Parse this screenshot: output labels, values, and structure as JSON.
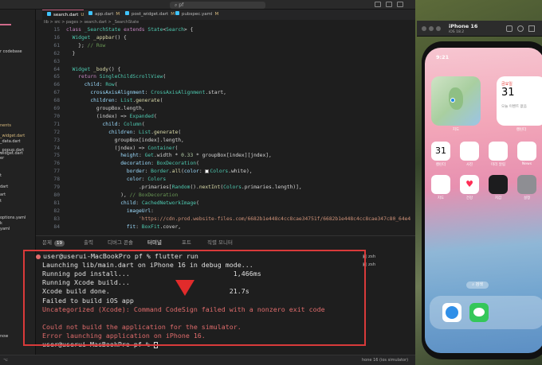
{
  "titlebar": {
    "search": "pf"
  },
  "tabs": [
    {
      "label": "search.dart",
      "modified": "U",
      "active": true
    },
    {
      "label": "app.dart",
      "modified": "M",
      "active": false
    },
    {
      "label": "post_widget.dart",
      "modified": "M",
      "active": false
    },
    {
      "label": "pubspec.yaml",
      "modified": "M",
      "active": false
    }
  ],
  "breadcrumb": "lib > src > pages > search.dart > _SearchState",
  "sidebar": {
    "items": [
      {
        "label": "r codebase",
        "color": "#d0d0d0"
      },
      {
        "label": "nents",
        "color": "#d7ba7d"
      },
      {
        "label": "_widget.dart",
        "color": "#d7ba7d"
      },
      {
        "label": "_data.dart",
        "color": "#d0d0d0"
      },
      {
        "label": "_popup.dart",
        "color": "#d0d0d0"
      },
      {
        "label": "widget.dart",
        "color": "#d0d0d0"
      },
      {
        "label": "er",
        "color": "#d0d0d0"
      },
      {
        "label": "t",
        "color": "#d0d0d0"
      },
      {
        "label": "dart",
        "color": "#d0d0d0"
      },
      {
        "label": "art",
        "color": "#d0d0d0"
      },
      {
        "label": "t",
        "color": "#d0d0d0"
      },
      {
        "label": "options.yaml",
        "color": "#d0d0d0"
      },
      {
        "label": "k",
        "color": "#d0d0d0"
      },
      {
        "label": "yaml",
        "color": "#d0d0d0"
      },
      {
        "label": "now",
        "color": "#d0d0d0"
      }
    ]
  },
  "editor": {
    "lines": [
      {
        "n": "15",
        "html": "<span class='kw'>class</span> <span class='ty'>_SearchState</span> <span class='kw'>extends</span> <span class='ty'>State</span>&lt;<span class='ty'>Search</span>&gt; {"
      },
      {
        "n": "16",
        "html": "  <span class='ty'>Widget</span> <span class='fn'>_appbar</span>() {"
      },
      {
        "n": "61",
        "html": "    }; <span class='cm'>// Row</span>"
      },
      {
        "n": "62",
        "html": "  }"
      },
      {
        "n": "63",
        "html": ""
      },
      {
        "n": "64",
        "html": "  <span class='ty'>Widget</span> <span class='fn'>_body</span>() {"
      },
      {
        "n": "65",
        "html": "    <span class='kw'>return</span> <span class='ty'>SingleChildScrollView</span>("
      },
      {
        "n": "66",
        "html": "      <span class='pr'>child</span>: <span class='ty'>Row</span>("
      },
      {
        "n": "67",
        "html": "        <span class='pr'>crossAxisAlignment</span>: <span class='ty'>CrossAxisAlignment</span>.start,"
      },
      {
        "n": "68",
        "html": "        <span class='pr'>children</span>: <span class='ty'>List</span>.<span class='fn'>generate</span>("
      },
      {
        "n": "69",
        "html": "          groupBox.length,"
      },
      {
        "n": "70",
        "html": "          (index) =&gt; <span class='ty'>Expanded</span>("
      },
      {
        "n": "71",
        "html": "            <span class='pr'>child</span>: <span class='ty'>Column</span>("
      },
      {
        "n": "72",
        "html": "              <span class='pr'>children</span>: <span class='ty'>List</span>.<span class='fn'>generate</span>("
      },
      {
        "n": "73",
        "html": "                groupBox[index].length,"
      },
      {
        "n": "74",
        "html": "                (jndex) =&gt; <span class='ty'>Container</span>("
      },
      {
        "n": "75",
        "html": "                  <span class='pr'>height</span>: <span class='ty'>Get</span>.width * <span class='nm'>0.33</span> * groupBox[index][jndex],"
      },
      {
        "n": "76",
        "html": "                  <span class='pr'>decoration</span>: <span class='ty'>BoxDecoration</span>("
      },
      {
        "n": "77",
        "html": "                    <span class='pr'>border</span>: <span class='ty'>Border</span>.<span class='fn'>all</span>(<span class='pr'>color</span>: <span class='swatch'></span><span class='ty'>Colors</span>.white),"
      },
      {
        "n": "78",
        "html": "                    <span class='pr'>color</span>: <span class='ty'>Colors</span>"
      },
      {
        "n": "79",
        "html": "                        .primaries[<span class='ty'>Random</span>().<span class='fn'>nextInt</span>(<span class='ty'>Colors</span>.primaries.length)],"
      },
      {
        "n": "80",
        "html": "                  ), <span class='cm'>// BoxDecoration</span>"
      },
      {
        "n": "81",
        "html": "                  <span class='pr'>child</span>: <span class='ty'>CachedNetworkImage</span>("
      },
      {
        "n": "82",
        "html": "                    <span class='pr'>imageUrl</span>:"
      },
      {
        "n": "83",
        "html": "                        <span class='st'>'https://cdn.prod.website-files.com/6682b1e448c4cc8cae34751f/6682b1e448c4cc8cae347c80_64e4</span>"
      },
      {
        "n": "84",
        "html": "                    <span class='pr'>fit</span>: <span class='ty'>BoxFit</span>.cover,"
      }
    ]
  },
  "panel": {
    "tabs": [
      {
        "label": "문제",
        "badge": "19",
        "active": false
      },
      {
        "label": "출력",
        "active": false
      },
      {
        "label": "디버그 콘솔",
        "active": false
      },
      {
        "label": "터미널",
        "active": true
      },
      {
        "label": "포트",
        "active": false
      },
      {
        "label": "직렬 모니터",
        "active": false
      }
    ],
    "terminal_sessions": [
      "zsh",
      "zsh"
    ]
  },
  "terminal": {
    "lines": [
      {
        "text": "user@userui-MacBookPro pf % flutter run",
        "err": false,
        "dot": true
      },
      {
        "text": "Launching lib/main.dart on iPhone 16 in debug mode...",
        "err": false
      },
      {
        "text": "Running pod install...                          1,466ms",
        "err": false
      },
      {
        "text": "Running Xcode build...",
        "err": false
      },
      {
        "text": "Xcode build done.                              21.7s",
        "err": false
      },
      {
        "text": "Failed to build iOS app",
        "err": false
      },
      {
        "text": "Uncategorized (Xcode): Command CodeSign failed with a nonzero exit code",
        "err": true
      },
      {
        "text": "",
        "err": false
      },
      {
        "text": "Could not build the application for the simulator.",
        "err": true
      },
      {
        "text": "Error launching application on iPhone 16.",
        "err": true
      },
      {
        "text": "user@userui-MacBookPro pf % ",
        "err": false
      }
    ]
  },
  "statusbar": {
    "right": "hone 16 (ios simulator)"
  },
  "simulator": {
    "title": "iPhone 16",
    "subtitle": "iOS 18.2",
    "time": "9:21",
    "calendar_widget": {
      "day": "금요일",
      "date": "31",
      "note": "오늘 이벤트 없음",
      "label": "캘린더"
    },
    "map_label": "지도",
    "apps": [
      {
        "name": "캘린더",
        "color": "#ffffff",
        "glyph": "31"
      },
      {
        "name": "사진",
        "color": "#ffffff",
        "glyph": ""
      },
      {
        "name": "미리 알림",
        "color": "#ffffff",
        "glyph": ""
      },
      {
        "name": "News",
        "color": "#ffffff",
        "glyph": ""
      },
      {
        "name": "지도",
        "color": "#ffffff",
        "glyph": ""
      },
      {
        "name": "건강",
        "color": "#ffffff",
        "glyph": "♥"
      },
      {
        "name": "지갑",
        "color": "#1c1c1e",
        "glyph": ""
      },
      {
        "name": "설정",
        "color": "#8e8e93",
        "glyph": ""
      }
    ],
    "search_pill": "검색",
    "dock": [
      {
        "name": "Safari",
        "color": "#ffffff"
      },
      {
        "name": "메시지",
        "color": "#34c759"
      }
    ]
  }
}
